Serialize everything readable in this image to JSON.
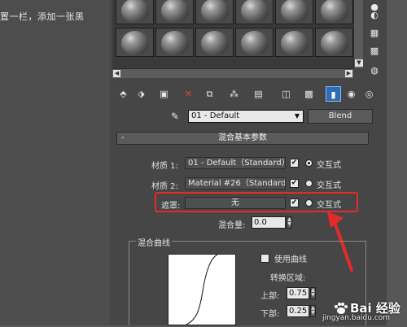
{
  "lead_text": "置一栏，添加一张黑",
  "sample_slots": 12,
  "toolbar": {
    "tools": [
      "get-material-icon",
      "put-to-scene-icon",
      "assign-material-icon",
      "reset-map-icon",
      "make-copy-icon",
      "make-unique-icon",
      "put-to-library-icon",
      "material-id-icon",
      "show-map-icon",
      "show-end-result-icon",
      "go-to-parent-icon",
      "go-forward-icon"
    ]
  },
  "name_row": {
    "material_name": "01 - Default",
    "material_type": "Blend"
  },
  "rollout": {
    "title": "混合基本参数",
    "collapse": "-"
  },
  "material1": {
    "label": "材质 1:",
    "value": "01 - Default（Standard）",
    "interactive_label": "交互式",
    "checked": "✔"
  },
  "material2": {
    "label": "材质 2:",
    "value": "Material #26（Standard）",
    "interactive_label": "交互式",
    "checked": "✔"
  },
  "mask": {
    "label": "遮罩:",
    "value": "无",
    "interactive_label": "交互式",
    "checked": "✔"
  },
  "mix_amount": {
    "label": "混合量:",
    "value": "0.0"
  },
  "mix_curve": {
    "legend": "混合曲线",
    "use_curve_label": "使用曲线",
    "transition_label": "转换区域:",
    "upper_label": "上部:",
    "upper_value": "0.75",
    "lower_label": "下部:",
    "lower_value": "0.25"
  },
  "watermark": {
    "logo_text": "Bai 经验",
    "url": "jingyan.baidu.com"
  },
  "colors": {
    "highlight": "#e62a2a",
    "panel": "#464646",
    "active_tool": "#2d6db8"
  }
}
